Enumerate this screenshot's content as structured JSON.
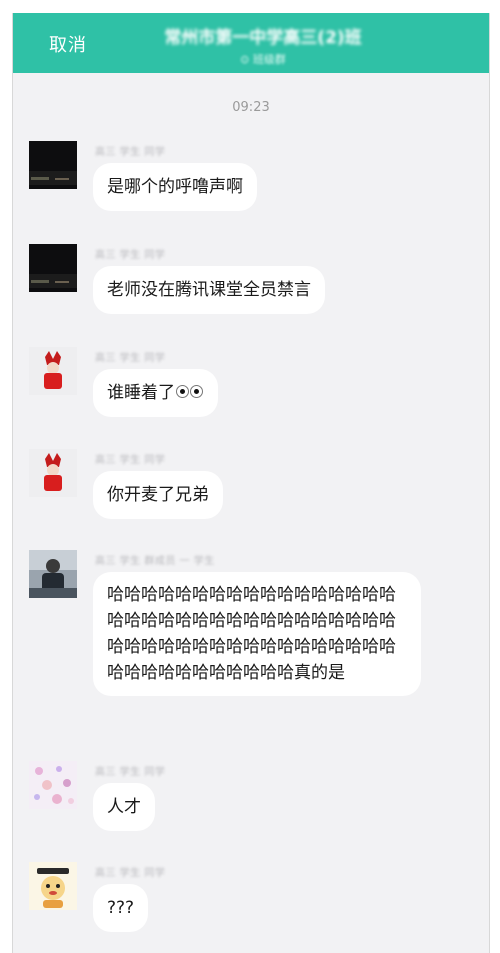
{
  "header": {
    "cancel_label": "取消",
    "title": "常州市第一中学高三(2)班",
    "subtitle": "⊙ 班级群"
  },
  "timestamp": "09:23",
  "messages": [
    {
      "nick": "高三 学生 同学",
      "text": "是哪个的呼噜声啊",
      "avatar": "dark-photo"
    },
    {
      "nick": "高三 学生 同学",
      "text": "老师没在腾讯课堂全员禁言",
      "avatar": "dark-photo"
    },
    {
      "nick": "高三 学生 同学",
      "text": "谁睡着了",
      "avatar": "red-character",
      "emoji": "eyes-emoji"
    },
    {
      "nick": "高三 学生 同学",
      "text": "你开麦了兄弟",
      "avatar": "red-character"
    },
    {
      "nick": "高三 学生 群成员 一 学生",
      "text": "哈哈哈哈哈哈哈哈哈哈哈哈哈哈哈哈哈哈哈哈哈哈哈哈哈哈哈哈哈哈哈哈哈哈哈哈哈哈哈哈哈哈哈哈哈哈哈哈哈哈哈哈哈哈哈哈哈哈哈哈哈哈真的是",
      "avatar": "person-photo"
    },
    {
      "nick": "高三 学生 同学",
      "text": "人才",
      "avatar": "pink-pattern"
    },
    {
      "nick": "高三 学生 同学",
      "text": "???",
      "avatar": "cartoon-character"
    }
  ],
  "colors": {
    "header": "#2fc1a6",
    "background": "#f2f2f4",
    "bubble": "#ffffff",
    "text": "#1a1a1a"
  }
}
